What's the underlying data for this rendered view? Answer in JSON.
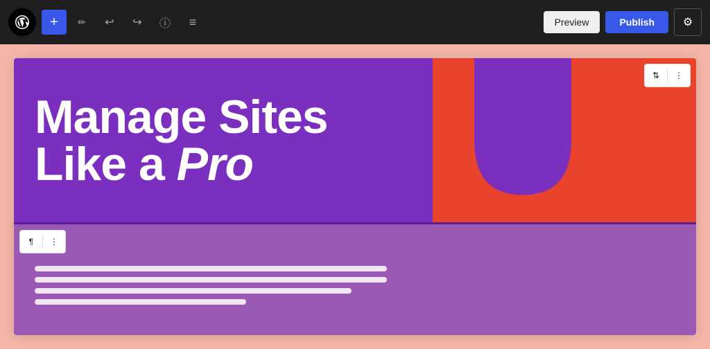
{
  "toolbar": {
    "add_label": "+",
    "preview_label": "Preview",
    "publish_label": "Publish",
    "undo_icon": "↩",
    "redo_icon": "↪",
    "info_icon": "ⓘ",
    "list_icon": "≡",
    "edit_icon": "✏",
    "settings_icon": "⚙"
  },
  "hero": {
    "line1": "Manage Sites",
    "line2_normal": "Like a ",
    "line2_bold": "Pro"
  },
  "block_controls": {
    "move_icon": "⇅",
    "more_icon": "⋮",
    "paragraph_icon": "¶"
  },
  "colors": {
    "toolbar_bg": "#1e1e1e",
    "hero_bg": "#7b2fbe",
    "hero_shape_bg": "#e8432d",
    "content_bg": "#9b59b6",
    "add_btn_bg": "#3858e9",
    "publish_btn_bg": "#3858e9",
    "preview_btn_bg": "#f0f0f0",
    "page_bg": "#f5b8a8"
  }
}
